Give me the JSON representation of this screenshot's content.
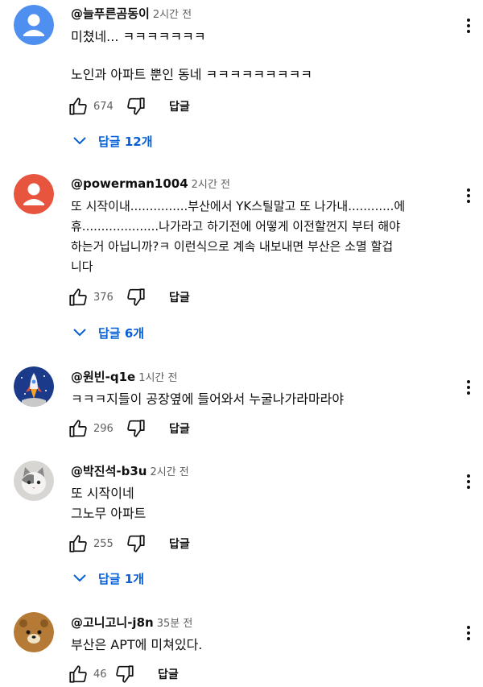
{
  "comments": [
    {
      "author": "@늘푸른곰동이",
      "time": "2시간 전",
      "lines": [
        "미쳤네... ㅋㅋㅋㅋㅋㅋㅋ",
        "",
        "노인과 아파트 뿐인 동네 ㅋㅋㅋㅋㅋㅋㅋㅋㅋ"
      ],
      "likes": "674",
      "reply_label": "답글",
      "replies": "답글 12개",
      "avatar": "default-user"
    },
    {
      "author": "@powerman1004",
      "time": "2시간 전",
      "lines": [
        "또 시작이내...............부산에서 YK스틸말고 또 나가내............에",
        "휴....................나가라고 하기전에 어떻게 이전할껀지 부터 해야",
        "하는거 아닙니까?ㅋ 이런식으로 계속 내보내면 부산은 소멸 할겁",
        "니다"
      ],
      "likes": "376",
      "reply_label": "답글",
      "replies": "답글 6개",
      "avatar": "default-user"
    },
    {
      "author": "@원빈-q1e",
      "time": "1시간 전",
      "lines": [
        "ㅋㅋㅋ지들이 공장옆에 들어와서 누굴나가라마라야"
      ],
      "likes": "296",
      "reply_label": "답글",
      "replies": "",
      "avatar": "rocket"
    },
    {
      "author": "@박진석-b3u",
      "time": "2시간 전",
      "lines": [
        "또 시작이네",
        "그노무 아파트"
      ],
      "likes": "255",
      "reply_label": "답글",
      "replies": "답글 1개",
      "avatar": "cat"
    },
    {
      "author": "@고니고니-j8n",
      "time": "35분 전",
      "lines": [
        "부산은 APT에 미쳐있다."
      ],
      "likes": "46",
      "reply_label": "답글",
      "replies": "",
      "avatar": "bear"
    }
  ],
  "colors": {
    "avatar_blue": "#4f8ff0",
    "avatar_red": "#e8553f",
    "link_blue": "#065fd4",
    "bear_brown": "#b57a35"
  }
}
